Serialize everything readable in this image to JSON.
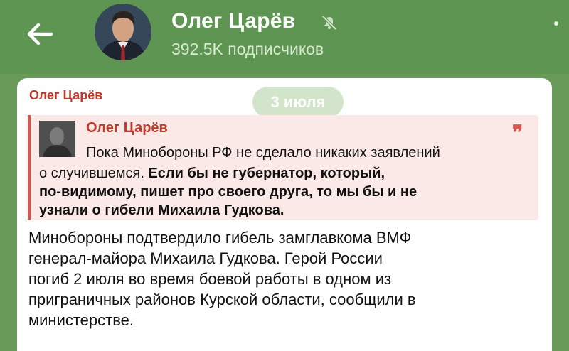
{
  "header": {
    "title": "Олег Царёв",
    "subscribers": "392.5K подписчиков"
  },
  "post": {
    "author": "Олег Царёв",
    "date": "3 июля",
    "quote": {
      "author": "Олег Царёв",
      "line1": "Пока Минобороны РФ не сделало никаких заявлений",
      "line2_plain": "о случившемся. ",
      "line2_bold": "Если бы не губернатор, который,",
      "line3": "по-видимому, пишет про своего друга, то мы бы и не",
      "line4": "узнали о гибели Михаила Гудкова."
    },
    "body": [
      "Минобороны подтвердило гибель замглавкома ВМФ",
      "генерал-майора Михаила Гудкова. Герой России",
      "погиб 2 июля во время боевой работы в одном из",
      "приграничных районов Курской области, сообщили в",
      "министерстве."
    ]
  },
  "icons": {
    "back": "arrow-left-icon",
    "mute": "muted-bell-icon",
    "more": "vertical-dots-icon",
    "quote": "quote-mark-icon"
  },
  "colors": {
    "header": "#5e9552",
    "accent": "#c0392b",
    "quote_bg": "#fbe9e7"
  }
}
